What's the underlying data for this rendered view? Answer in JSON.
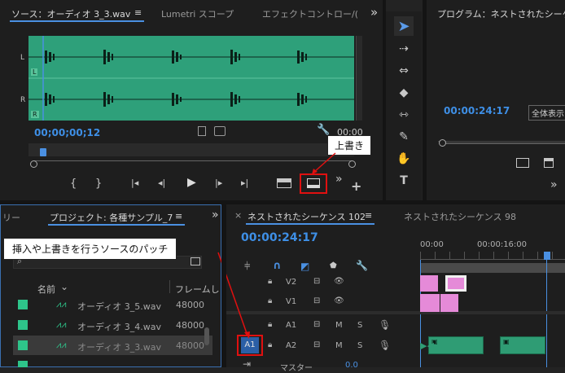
{
  "source_panel": {
    "tabs": [
      {
        "label": "ソース：オーディオ 3_3.wav"
      },
      {
        "label": "Lumetri スコープ"
      },
      {
        "label": "エフェクトコントロー/("
      }
    ],
    "menu_glyph": "≡",
    "overflow_glyph": "»",
    "timecode": "00;00;00;12",
    "timecode_right": "00;00",
    "channel_labels": [
      "L",
      "R"
    ],
    "channel_markers": [
      "L",
      "R"
    ]
  },
  "program_panel": {
    "title": "プログラム：ネストされたシーケン",
    "timecode": "00:00:24:17",
    "fit_label": "全体表示"
  },
  "project_panel": {
    "tab_left": "リー",
    "tab": "プロジェクト: 各種サンプル_7",
    "menu_glyph": "≡",
    "overflow_glyph": "»",
    "columns": [
      "名前",
      "フレームし"
    ],
    "items": [
      {
        "name": "オーディオ 3_5.wav",
        "rate": "48000"
      },
      {
        "name": "オーディオ 3_4.wav",
        "rate": "48000"
      },
      {
        "name": "オーディオ 3_3.wav",
        "rate": "48000"
      }
    ]
  },
  "timeline_panel": {
    "close_glyph": "×",
    "tabs": [
      {
        "label": "ネストされたシーケンス 102"
      },
      {
        "label": "ネストされたシーケンス 98"
      }
    ],
    "menu_glyph": "≡",
    "timecode": "00:00:24:17",
    "ruler": [
      "00:00",
      "00:00:16:00"
    ],
    "tracks": [
      {
        "source": "",
        "name": "V2"
      },
      {
        "source": "",
        "name": "V1"
      },
      {
        "source": "",
        "name": "A1",
        "m": "M",
        "s": "S"
      },
      {
        "source": "A1",
        "name": "A2",
        "m": "M",
        "s": "S"
      }
    ],
    "master_label": "マスター",
    "master_value": "0.0"
  },
  "callouts": {
    "overwrite": "上書き",
    "patch": "挿入や上書きを行うソースのパッチ"
  },
  "colors": {
    "waveform_bg": "#2ea07a",
    "timecode": "#3e8fe6",
    "highlight": "#e01010",
    "video_clip": "#e58ad8",
    "audio_clip": "#2f9c74",
    "playhead": "#4a90e2"
  },
  "icons": {
    "selection": "selection-arrow-icon",
    "track_select": "track-select-forward-icon",
    "ripple": "ripple-edit-icon",
    "razor": "razor-icon",
    "slip": "slip-icon",
    "pen": "pen-icon",
    "hand": "hand-icon",
    "type": "type-icon"
  }
}
